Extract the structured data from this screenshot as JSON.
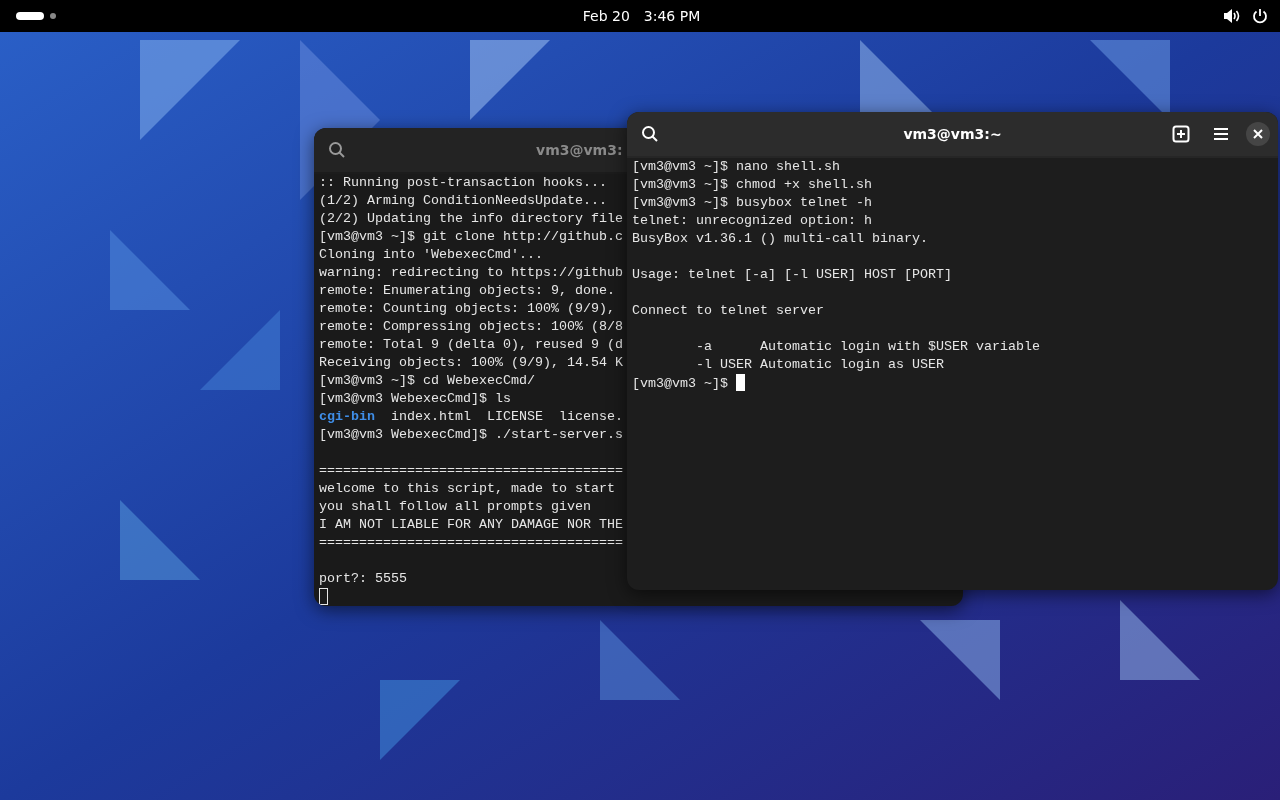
{
  "top_bar": {
    "date": "Feb 20",
    "time": "3:46 PM"
  },
  "windows": [
    {
      "title": "vm3@vm3:",
      "focused": false,
      "lines": [
        {
          "kind": "output",
          "text": ":: Running post-transaction hooks..."
        },
        {
          "kind": "output",
          "text": "(1/2) Arming ConditionNeedsUpdate..."
        },
        {
          "kind": "output",
          "text": "(2/2) Updating the info directory file"
        },
        {
          "kind": "output",
          "text": "[vm3@vm3 ~]$ git clone http://github.c"
        },
        {
          "kind": "output",
          "text": "Cloning into 'WebexecCmd'..."
        },
        {
          "kind": "output",
          "text": "warning: redirecting to https://github"
        },
        {
          "kind": "output",
          "text": "remote: Enumerating objects: 9, done."
        },
        {
          "kind": "output",
          "text": "remote: Counting objects: 100% (9/9),"
        },
        {
          "kind": "output",
          "text": "remote: Compressing objects: 100% (8/8"
        },
        {
          "kind": "output",
          "text": "remote: Total 9 (delta 0), reused 9 (d"
        },
        {
          "kind": "output",
          "text": "Receiving objects: 100% (9/9), 14.54 K"
        },
        {
          "kind": "output",
          "text": "[vm3@vm3 ~]$ cd WebexecCmd/"
        },
        {
          "kind": "output",
          "text": "[vm3@vm3 WebexecCmd]$ ls"
        },
        {
          "kind": "listing",
          "segments": [
            {
              "text": "cgi-bin",
              "kind": "directory"
            },
            {
              "text": "  index.html  LICENSE  license.",
              "kind": "file"
            }
          ]
        },
        {
          "kind": "output",
          "text": "[vm3@vm3 WebexecCmd]$ ./start-server.s"
        },
        {
          "kind": "blank"
        },
        {
          "kind": "output",
          "text": "======================================"
        },
        {
          "kind": "output",
          "text": "welcome to this script, made to start"
        },
        {
          "kind": "output",
          "text": "you shall follow all prompts given"
        },
        {
          "kind": "output",
          "text": "I AM NOT LIABLE FOR ANY DAMAGE NOR THE"
        },
        {
          "kind": "output",
          "text": "======================================"
        },
        {
          "kind": "blank"
        },
        {
          "kind": "output",
          "text": "port?: 5555"
        },
        {
          "kind": "cursor"
        }
      ]
    },
    {
      "title": "vm3@vm3:~",
      "focused": true,
      "lines": [
        {
          "kind": "output",
          "text": "[vm3@vm3 ~]$ nano shell.sh"
        },
        {
          "kind": "output",
          "text": "[vm3@vm3 ~]$ chmod +x shell.sh"
        },
        {
          "kind": "output",
          "text": "[vm3@vm3 ~]$ busybox telnet -h"
        },
        {
          "kind": "output",
          "text": "telnet: unrecognized option: h"
        },
        {
          "kind": "output",
          "text": "BusyBox v1.36.1 () multi-call binary."
        },
        {
          "kind": "blank"
        },
        {
          "kind": "output",
          "text": "Usage: telnet [-a] [-l USER] HOST [PORT]"
        },
        {
          "kind": "blank"
        },
        {
          "kind": "output",
          "text": "Connect to telnet server"
        },
        {
          "kind": "blank"
        },
        {
          "kind": "output",
          "text": "        -a      Automatic login with $USER variable"
        },
        {
          "kind": "output",
          "text": "        -l USER Automatic login as USER"
        },
        {
          "kind": "prompt",
          "text": "[vm3@vm3 ~]$"
        }
      ]
    }
  ]
}
